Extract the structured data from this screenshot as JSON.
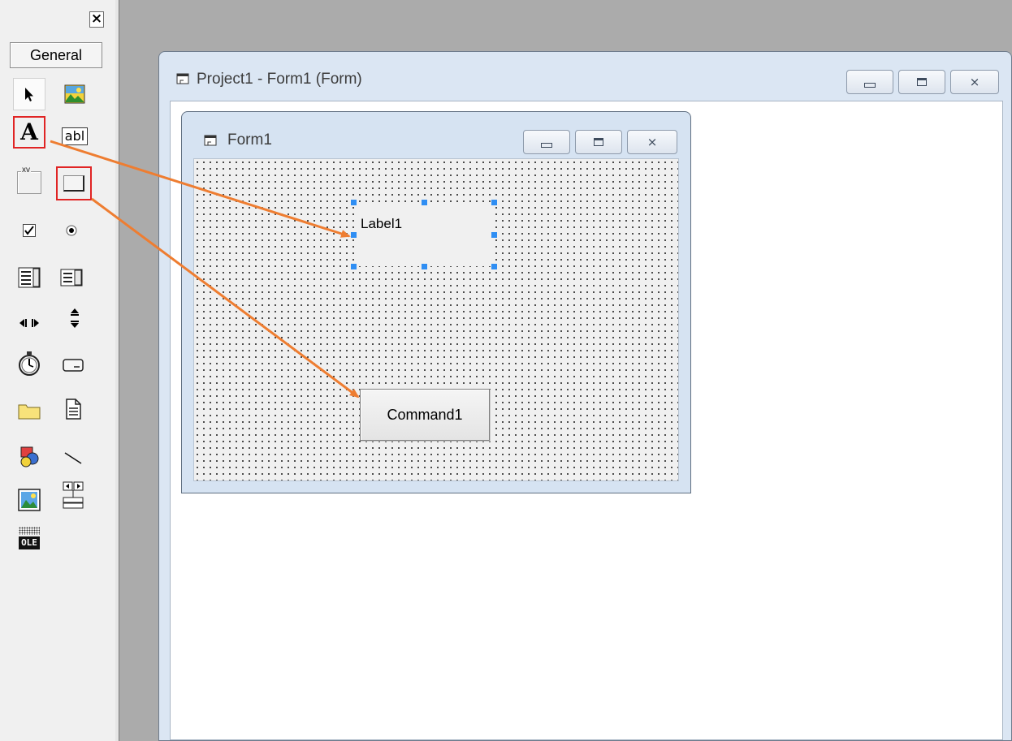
{
  "toolbox": {
    "close_glyph": "×",
    "tab_label": "General",
    "tools": [
      {
        "name": "pointer"
      },
      {
        "name": "picturebox"
      },
      {
        "name": "label"
      },
      {
        "name": "textbox",
        "text": "abl"
      },
      {
        "name": "frame",
        "text": "xv"
      },
      {
        "name": "commandbutton"
      },
      {
        "name": "checkbox"
      },
      {
        "name": "optionbutton"
      },
      {
        "name": "combobox"
      },
      {
        "name": "listbox"
      },
      {
        "name": "hscrollbar"
      },
      {
        "name": "vscrollbar"
      },
      {
        "name": "timer"
      },
      {
        "name": "drivelistbox"
      },
      {
        "name": "dirlistbox"
      },
      {
        "name": "filelistbox"
      },
      {
        "name": "shape"
      },
      {
        "name": "line"
      },
      {
        "name": "image"
      },
      {
        "name": "data"
      },
      {
        "name": "ole",
        "text": "OLE"
      }
    ]
  },
  "project_window": {
    "title": "Project1 - Form1 (Form)"
  },
  "form": {
    "title": "Form1",
    "label_caption": "Label1",
    "button_caption": "Command1"
  },
  "colors": {
    "annotation_arrow": "#ee7d31",
    "highlight_box": "#e02424",
    "selection_handle": "#2f8ef3"
  }
}
